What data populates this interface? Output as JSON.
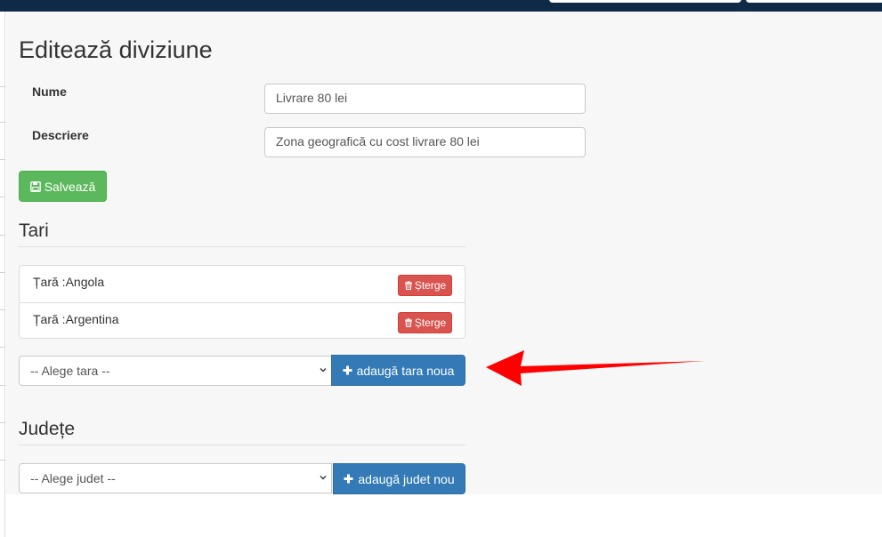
{
  "page": {
    "title": "Editează diviziune"
  },
  "form": {
    "name_label": "Nume",
    "name_value": "Livrare 80 lei",
    "description_label": "Descriere",
    "description_value": "Zona geografică cu cost livrare 80 lei",
    "save_label": "Salvează"
  },
  "countries": {
    "title": "Tari",
    "items": [
      {
        "label": "Țară :Angola",
        "delete_label": "Șterge"
      },
      {
        "label": "Țară :Argentina",
        "delete_label": "Șterge"
      }
    ],
    "select_value": "-- Alege tara --",
    "add_label": "adaugă tara noua"
  },
  "counties": {
    "title": "Județe",
    "select_value": "-- Alege judet --",
    "add_label": "adaugă judet nou"
  },
  "colors": {
    "topbar": "#0f2a47",
    "success": "#5cb85c",
    "danger": "#d9534f",
    "primary": "#337ab7",
    "annotation_arrow": "#ff0000"
  },
  "icons": {
    "save": "floppy-disk-icon",
    "delete": "trash-icon",
    "add": "plus-icon",
    "dropdown": "chevron-down-icon"
  }
}
